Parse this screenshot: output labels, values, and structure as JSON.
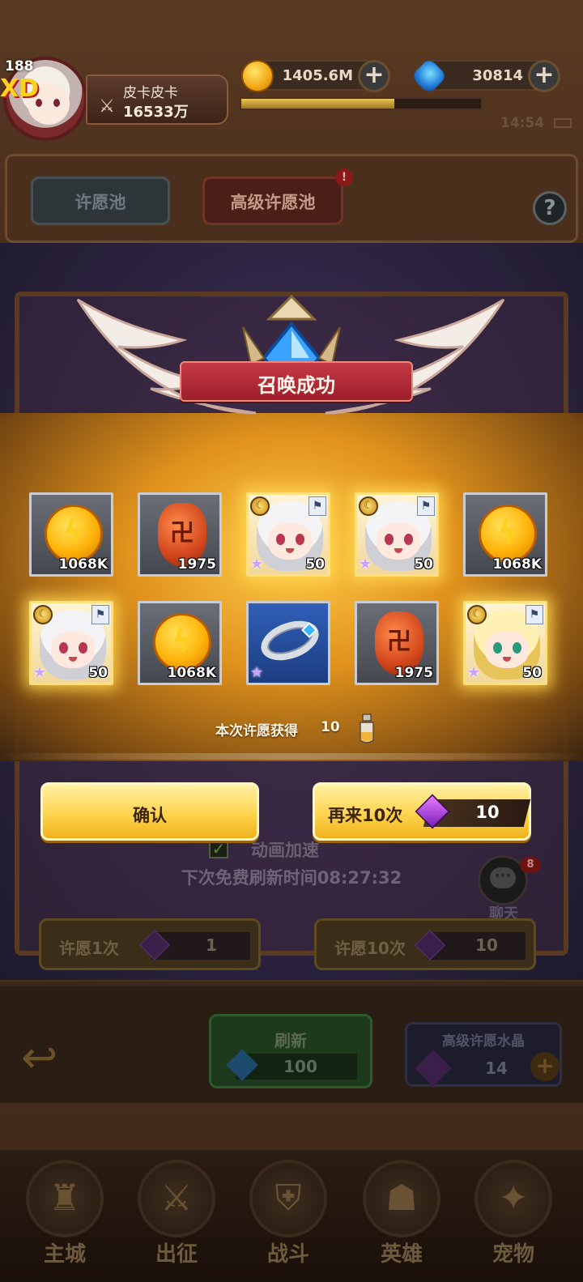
{
  "player": {
    "level": "188",
    "vip_tag": "XD",
    "name": "皮卡皮卡",
    "power": "16533万"
  },
  "resources": {
    "gold": "1405.6M",
    "diamonds": "30814",
    "exp_fraction": 0.64
  },
  "status_bar": {
    "time": "14:54"
  },
  "tabs": {
    "basic": "许愿池",
    "advanced": "高级许愿池",
    "advanced_badge": "!",
    "help": "?"
  },
  "modal": {
    "title": "召唤成功",
    "rewards": [
      {
        "kind": "coin",
        "qty": "1068K"
      },
      {
        "kind": "ore",
        "qty": "1975"
      },
      {
        "kind": "hero-silver",
        "qty": "50"
      },
      {
        "kind": "hero-silver",
        "qty": "50"
      },
      {
        "kind": "coin",
        "qty": "1068K"
      },
      {
        "kind": "hero-silver",
        "qty": "50"
      },
      {
        "kind": "coin",
        "qty": "1068K"
      },
      {
        "kind": "ring",
        "qty": ""
      },
      {
        "kind": "ore",
        "qty": "1975"
      },
      {
        "kind": "hero-gold",
        "qty": "50"
      }
    ],
    "gained_label": "本次许愿获得",
    "gained_count": "10",
    "confirm_label": "确认",
    "again_label": "再来10次",
    "again_cost": "10"
  },
  "background": {
    "animation_speedup": "动画加速",
    "next_free_refresh": "下次免费刷新时间08:27:32",
    "chat_label": "聊天",
    "chat_badge": "8",
    "wish_once_label": "许愿1次",
    "wish_once_cost": "1",
    "wish_ten_label": "许愿10次",
    "wish_ten_cost": "10",
    "refresh_label": "刷新",
    "refresh_cost": "100",
    "crystal_label": "高级许愿水晶",
    "crystal_count": "14"
  },
  "nav": [
    {
      "label": "主城",
      "icon": "castle-icon",
      "glyph": "♜"
    },
    {
      "label": "出征",
      "icon": "crossed-swords-icon",
      "glyph": "⚔"
    },
    {
      "label": "战斗",
      "icon": "battle-shield-icon",
      "glyph": "⛨"
    },
    {
      "label": "英雄",
      "icon": "hero-hood-icon",
      "glyph": "☗"
    },
    {
      "label": "宠物",
      "icon": "pet-dragon-icon",
      "glyph": "✦"
    }
  ],
  "colors": {
    "accent_gold": "#ffd44e",
    "title_red": "#c43a44",
    "glow_orange": "#e0921c"
  }
}
